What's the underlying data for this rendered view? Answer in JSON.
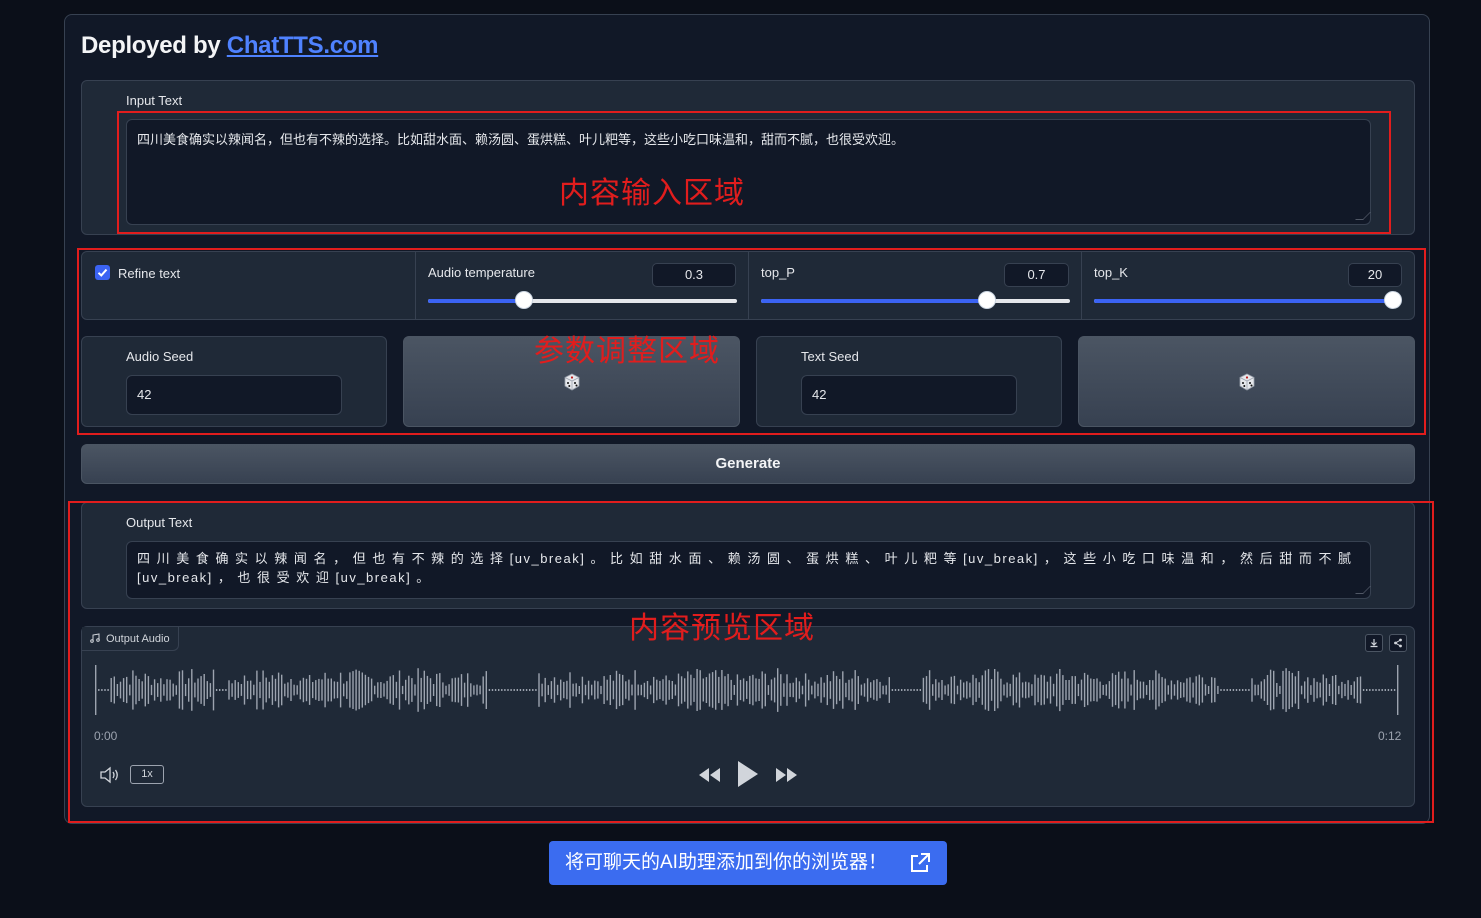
{
  "header": {
    "prefix": "Deployed by",
    "link_text": "ChatTTS.com"
  },
  "input": {
    "label": "Input Text",
    "value": "四川美食确实以辣闻名，但也有不辣的选择。比如甜水面、赖汤圆、蛋烘糕、叶儿粑等，这些小吃口味温和，甜而不腻，也很受欢迎。"
  },
  "params": {
    "refine_label": "Refine text",
    "refine_checked": true,
    "audio_temperature": {
      "label": "Audio temperature",
      "value": "0.3",
      "fraction": 0.31
    },
    "top_p": {
      "label": "top_P",
      "value": "0.7",
      "fraction": 0.73
    },
    "top_k": {
      "label": "top_K",
      "value": "20",
      "fraction": 1.0
    }
  },
  "seeds": {
    "audio_seed": {
      "label": "Audio Seed",
      "value": "42"
    },
    "text_seed": {
      "label": "Text Seed",
      "value": "42"
    }
  },
  "generate_label": "Generate",
  "output": {
    "label": "Output Text",
    "value": "四 川 美 食 确 实 以 辣 闻 名 ， 但 也 有 不 辣 的 选 择 [uv_break] 。 比 如 甜 水 面 、 赖 汤 圆 、 蛋 烘 糕 、 叶 儿 粑 等 [uv_break] ， 这 些 小 吃 口 味 温 和 ， 然 后 甜 而 不 腻 [uv_break] ， 也 很 受 欢 迎 [uv_break] 。"
  },
  "audio": {
    "label": "Output Audio",
    "time_start": "0:00",
    "time_end": "0:12",
    "speed": "1x",
    "icons": [
      "music-icon",
      "download-icon",
      "share-icon",
      "volume-icon",
      "rewind-icon",
      "play-icon",
      "fast-forward-icon"
    ]
  },
  "annotations": {
    "input_area": "内容输入区域",
    "params_area": "参数调整区域",
    "preview_area": "内容预览区域",
    "color": "#e11d1d"
  },
  "extension_button": "将可聊天的AI助理添加到你的浏览器！",
  "colors": {
    "background": "#0b0f19",
    "panel": "#1f2937",
    "accent": "#3b63f3",
    "link": "#4f82ff",
    "ext_button": "#3b6cf0"
  }
}
